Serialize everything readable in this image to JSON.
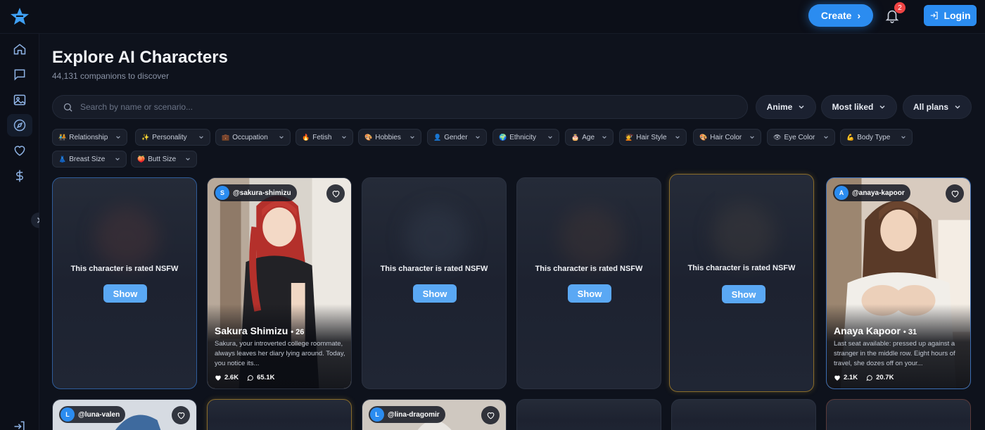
{
  "header": {
    "create_label": "Create",
    "create_chevron": "›",
    "notification_count": "2",
    "login_label": "Login",
    "colors": {
      "accent": "#2b8cf0",
      "badge": "#ef4444"
    }
  },
  "sidebar": {
    "items": [
      {
        "icon": "home-icon"
      },
      {
        "icon": "chat-icon"
      },
      {
        "icon": "image-icon"
      },
      {
        "icon": "compass-icon"
      },
      {
        "icon": "heart-icon"
      },
      {
        "icon": "dollar-icon"
      }
    ],
    "bottom_icon": "sign-in-icon"
  },
  "page": {
    "title": "Explore AI Characters",
    "subtitle": "44,131 companions to discover"
  },
  "search": {
    "placeholder": "Search by name or scenario..."
  },
  "dropdowns": [
    {
      "label": "Anime"
    },
    {
      "label": "Most liked"
    },
    {
      "label": "All plans"
    }
  ],
  "filters": [
    {
      "emoji": "🧑‍🤝‍🧑",
      "label": "Relationship"
    },
    {
      "emoji": "✨",
      "label": "Personality"
    },
    {
      "emoji": "💼",
      "label": "Occupation"
    },
    {
      "emoji": "🔥",
      "label": "Fetish"
    },
    {
      "emoji": "🎨",
      "label": "Hobbies"
    },
    {
      "emoji": "👤",
      "label": "Gender"
    },
    {
      "emoji": "🌍",
      "label": "Ethnicity"
    },
    {
      "emoji": "🎂",
      "label": "Age"
    },
    {
      "emoji": "💇",
      "label": "Hair Style"
    },
    {
      "emoji": "🎨",
      "label": "Hair Color"
    },
    {
      "emoji": "👁",
      "label": "Eye Color"
    },
    {
      "emoji": "💪",
      "label": "Body Type"
    },
    {
      "emoji": "👗",
      "label": "Breast Size"
    },
    {
      "emoji": "🍑",
      "label": "Butt Size"
    }
  ],
  "cards": {
    "nsfw_text": "This character is rated NSFW",
    "show_label": "Show",
    "sakura": {
      "avatar_letter": "S",
      "handle": "@sakura-shimizu",
      "name": "Sakura Shimizu",
      "age": "• 26",
      "description": "Sakura, your introverted college roommate, always leaves her diary lying around. Today, you notice its...",
      "likes": "2.6K",
      "chats": "65.1K"
    },
    "anaya": {
      "avatar_letter": "A",
      "handle": "@anaya-kapoor",
      "name": "Anaya Kapoor",
      "age": "• 31",
      "description": "Last seat available: pressed up against a stranger in the middle row. Eight hours of travel, she dozes off on your...",
      "likes": "2.1K",
      "chats": "20.7K"
    },
    "luna": {
      "avatar_letter": "L",
      "handle": "@luna-valen"
    },
    "lina": {
      "avatar_letter": "L",
      "handle": "@lina-dragomir"
    }
  }
}
